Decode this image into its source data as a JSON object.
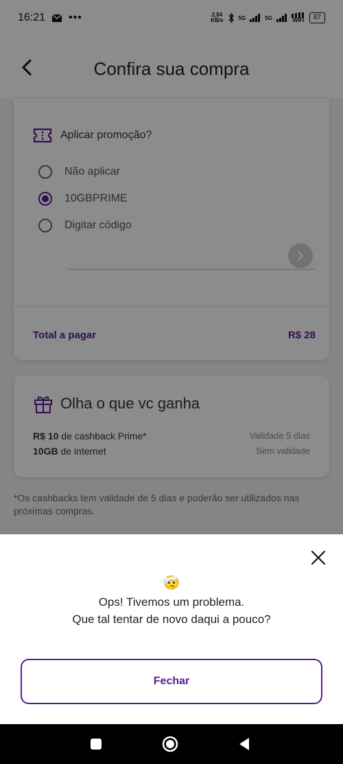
{
  "status_bar": {
    "time": "16:21",
    "net_speed_value": "2,84",
    "net_speed_unit": "KB/s",
    "sig1": "5G",
    "sig2": "5G",
    "wifi": "WIFI",
    "battery": "87"
  },
  "header": {
    "title": "Confira sua compra"
  },
  "promo": {
    "title": "Aplicar promoção?",
    "options": [
      {
        "label": "Não aplicar",
        "selected": false
      },
      {
        "label": "10GBPRIME",
        "selected": true
      },
      {
        "label": "Digitar código",
        "selected": false
      }
    ],
    "code_value": "",
    "total_label": "Total a pagar",
    "total_value": "R$ 28"
  },
  "gains": {
    "title": "Olha o que vc ganha",
    "items": [
      {
        "bold": "R$ 10",
        "text": "de cashback Prime*",
        "validity": "Validade 5 dias"
      },
      {
        "bold": "10GB",
        "text": "de internet",
        "validity": "Sem validade"
      }
    ]
  },
  "footnote": "*Os cashbacks tem validade de 5 dias e poderão ser utilizados nas próximas compras.",
  "error_sheet": {
    "emoji": "🤕",
    "line1": "Ops! Tivemos um problema.",
    "line2": "Que tal tentar de novo daqui a pouco?",
    "button": "Fechar"
  },
  "colors": {
    "accent": "#5b1a8e",
    "overlay": "rgba(0,0,0,0.45)"
  },
  "icons": [
    "back-arrow-icon",
    "ticket-icon",
    "gift-icon",
    "chevron-right-icon",
    "close-icon",
    "nav-recents-icon",
    "nav-home-icon",
    "nav-back-icon"
  ]
}
